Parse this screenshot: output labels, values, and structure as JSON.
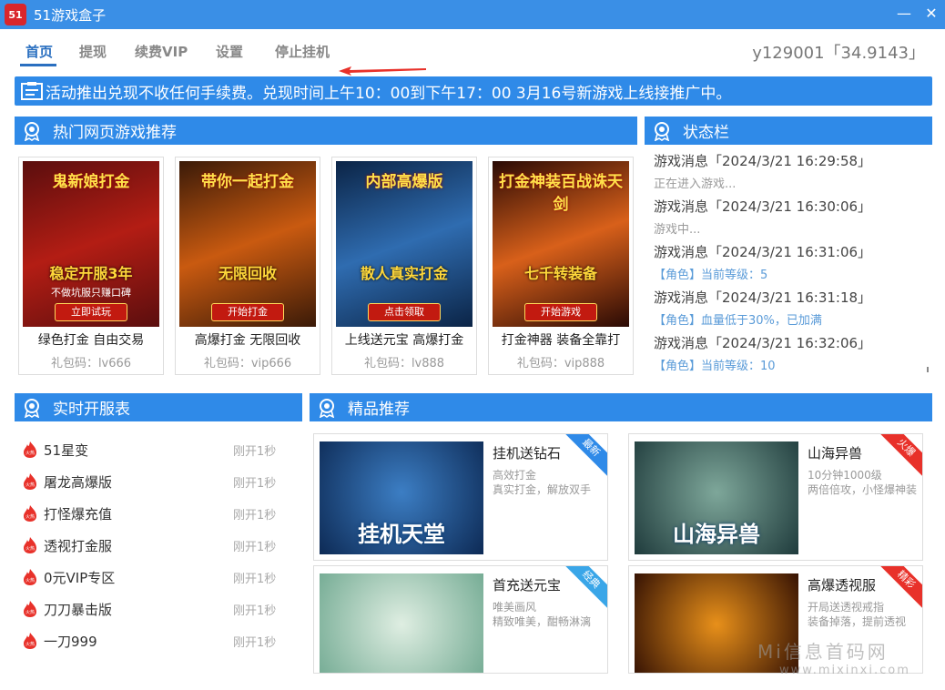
{
  "window": {
    "title": "51游戏盒子",
    "logo_text": "51",
    "minimize": "—",
    "close": "✕"
  },
  "nav": {
    "items": [
      "首页",
      "提现",
      "续费VIP",
      "设置",
      "停止挂机"
    ],
    "user": "y129001「34.9143」"
  },
  "notice": {
    "text": "活动推出兑现不收任何手续费。兑现时间上午10：00到下午17：00    3月16号新游戏上线接推广中。"
  },
  "sections": {
    "hot": "热门网页游戏推荐",
    "status": "状态栏",
    "servers": "实时开服表",
    "premium": "精品推荐"
  },
  "games": [
    {
      "name": "绿色打金 自由交易",
      "code": "礼包码：lv666",
      "img_top": "鬼新娘打金",
      "img_mid": "稳定开服3年",
      "img_low": "不做坑服只赚口碑",
      "img_btn": "立即试玩",
      "color1": "#5a0e0e",
      "color2": "#b31d14"
    },
    {
      "name": "高爆打金 无限回收",
      "code": "礼包码：vip666",
      "img_top": "带你一起打金",
      "img_mid": "无限回收",
      "img_low": "",
      "img_btn": "开始打金",
      "color1": "#3a1a08",
      "color2": "#c95a10"
    },
    {
      "name": "上线送元宝 高爆打金",
      "code": "礼包码：lv888",
      "img_top": "内部高爆版",
      "img_mid": "散人真实打金",
      "img_low": "",
      "img_btn": "点击领取",
      "color1": "#0b2446",
      "color2": "#2f6cb0"
    },
    {
      "name": "打金神器 装备全靠打",
      "code": "礼包码：vip888",
      "img_top": "打金神装百战诛天剑",
      "img_mid": "七千转装备",
      "img_low": "",
      "img_btn": "开始游戏",
      "color1": "#2a0a05",
      "color2": "#d8601a"
    }
  ],
  "status_items": [
    {
      "title": "游戏消息「2024/3/21 16:29:58」",
      "sub": "正在进入游戏...",
      "blue": false
    },
    {
      "title": "游戏消息「2024/3/21 16:30:06」",
      "sub": "游戏中...",
      "blue": false
    },
    {
      "title": "游戏消息「2024/3/21 16:31:06」",
      "sub": "【角色】当前等级：5",
      "blue": true
    },
    {
      "title": "游戏消息「2024/3/21 16:31:18」",
      "sub": "【角色】血量低于30%，已加满",
      "blue": true
    },
    {
      "title": "游戏消息「2024/3/21 16:32:06」",
      "sub": "【角色】当前等级：10",
      "blue": true
    }
  ],
  "servers": [
    {
      "name": "51星变",
      "time": "刚开1秒"
    },
    {
      "name": "屠龙高爆版",
      "time": "刚开1秒"
    },
    {
      "name": "打怪爆充值",
      "time": "刚开1秒"
    },
    {
      "name": "透视打金服",
      "time": "刚开1秒"
    },
    {
      "name": "0元VIP专区",
      "time": "刚开1秒"
    },
    {
      "name": "刀刀暴击版",
      "time": "刚开1秒"
    },
    {
      "name": "一刀999",
      "time": "刚开1秒"
    }
  ],
  "fire_label": "火热",
  "premium": [
    {
      "title": "挂机送钻石",
      "line1": "高效打金",
      "line2": "真实打金，解放双手",
      "ribbon": "最新",
      "ribbon_color": "#2f8ae8",
      "img_text": "挂机天堂",
      "color1": "#0d2a55",
      "color2": "#3c7ec4"
    },
    {
      "title": "山海异兽",
      "line1": "10分钟1000级",
      "line2": "两倍倍攻，小怪爆神装",
      "ribbon": "火爆",
      "ribbon_color": "#e8312a",
      "img_text": "山海异兽",
      "color1": "#1f3b3c",
      "color2": "#7ea79a"
    },
    {
      "title": "首充送元宝",
      "line1": "唯美画风",
      "line2": "精致唯美，酣畅淋漓",
      "ribbon": "经典",
      "ribbon_color": "#3aa6e8",
      "img_text": "",
      "color1": "#6fa890",
      "color2": "#dfeee2"
    },
    {
      "title": "高爆透视服",
      "line1": "开局送透视戒指",
      "line2": "装备掉落，提前透视",
      "ribbon": "精彩",
      "ribbon_color": "#e8312a",
      "img_text": "",
      "color1": "#2a0a02",
      "color2": "#e8901a"
    }
  ],
  "watermark": {
    "line1": "Mi信息首码网",
    "line2": "www.mixinxi.com"
  }
}
